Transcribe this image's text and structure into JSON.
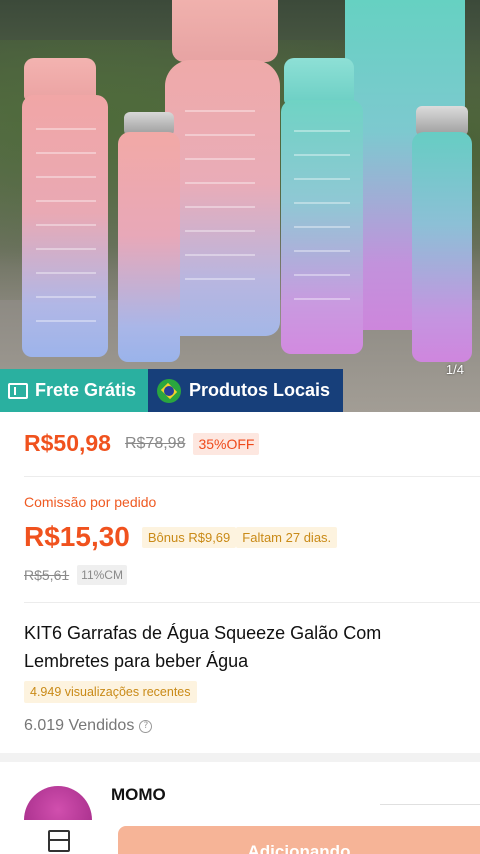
{
  "product_image": {
    "counter": "1/4",
    "badges": {
      "free_shipping": "Frete Grátis",
      "local_products": "Produtos Locais"
    }
  },
  "price": {
    "current": "R$50,98",
    "original": "R$78,98",
    "discount": "35%OFF"
  },
  "commission": {
    "label": "Comissão por pedido",
    "value": "R$15,30",
    "bonus": "Bônus R$9,69",
    "days_left": "Faltam 27 dias.",
    "old_value": "R$5,61",
    "rate": "11%CM"
  },
  "product": {
    "title": "KIT6 Garrafas de  Água Squeeze Galão Com Lembretes para beber Água",
    "recent_views": "4.949 visualizações recentes",
    "sold": "6.019 Vendidos"
  },
  "shop": {
    "name": "MOMO"
  },
  "bottom_bar": {
    "cta_label": "Adicionando"
  },
  "colors": {
    "accent": "#f0521e",
    "free_shipping_bg": "#2ab0a0",
    "local_products_bg": "#173f7a",
    "bonus_bg": "#fdf3df",
    "bonus_text": "#c98a17",
    "cta_bg": "#f6b497"
  },
  "icons": [
    "truck-icon",
    "brazil-flag-icon",
    "info-icon",
    "store-icon"
  ]
}
